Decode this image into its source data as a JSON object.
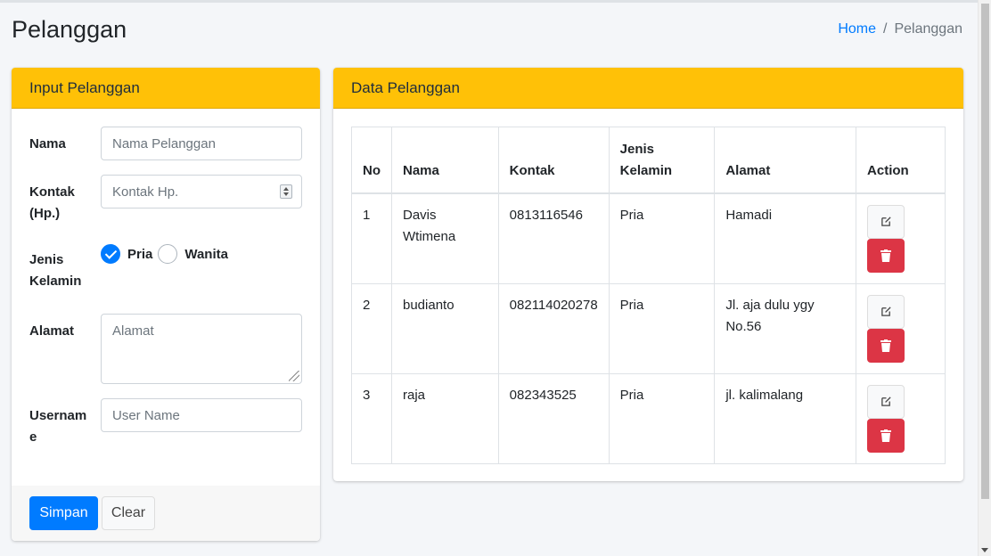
{
  "page": {
    "title": "Pelanggan"
  },
  "breadcrumb": {
    "home": "Home",
    "separator": "/",
    "current": "Pelanggan"
  },
  "input_card": {
    "title": "Input Pelanggan",
    "fields": {
      "nama": {
        "label": "Nama",
        "placeholder": "Nama Pelanggan",
        "value": ""
      },
      "kontak": {
        "label_line1": "Kontak",
        "label_line2": "(Hp.)",
        "placeholder": "Kontak Hp.",
        "value": ""
      },
      "jenis_kelamin": {
        "label_line1": "Jenis",
        "label_line2": "Kelamin",
        "options": [
          "Pria",
          "Wanita"
        ],
        "selected": "Pria"
      },
      "alamat": {
        "label": "Alamat",
        "placeholder": "Alamat",
        "value": ""
      },
      "username": {
        "label_line1": "Usernam",
        "label_line2": "e",
        "placeholder": "User Name",
        "value": ""
      }
    },
    "buttons": {
      "save": "Simpan",
      "clear": "Clear"
    }
  },
  "data_card": {
    "title": "Data Pelanggan",
    "columns": {
      "no": "No",
      "nama": "Nama",
      "kontak": "Kontak",
      "jk_line1": "Jenis",
      "jk_line2": "Kelamin",
      "alamat": "Alamat",
      "action": "Action"
    },
    "rows": [
      {
        "no": "1",
        "nama_line1": "Davis",
        "nama_line2": "Wtimena",
        "kontak": "0813116546",
        "jenis_kelamin": "Pria",
        "alamat_line1": "Hamadi",
        "alamat_line2": ""
      },
      {
        "no": "2",
        "nama_line1": "budianto",
        "nama_line2": "",
        "kontak": "082114020278",
        "jenis_kelamin": "Pria",
        "alamat_line1": "Jl. aja dulu ygy",
        "alamat_line2": "No.56"
      },
      {
        "no": "3",
        "nama_line1": "raja",
        "nama_line2": "",
        "kontak": "082343525",
        "jenis_kelamin": "Pria",
        "alamat_line1": "jl. kalimalang",
        "alamat_line2": ""
      }
    ]
  },
  "colors": {
    "header": "#ffc107",
    "primary": "#007bff",
    "danger": "#dc3545"
  },
  "icons": {
    "edit": "edit-icon",
    "delete": "trash-icon"
  }
}
